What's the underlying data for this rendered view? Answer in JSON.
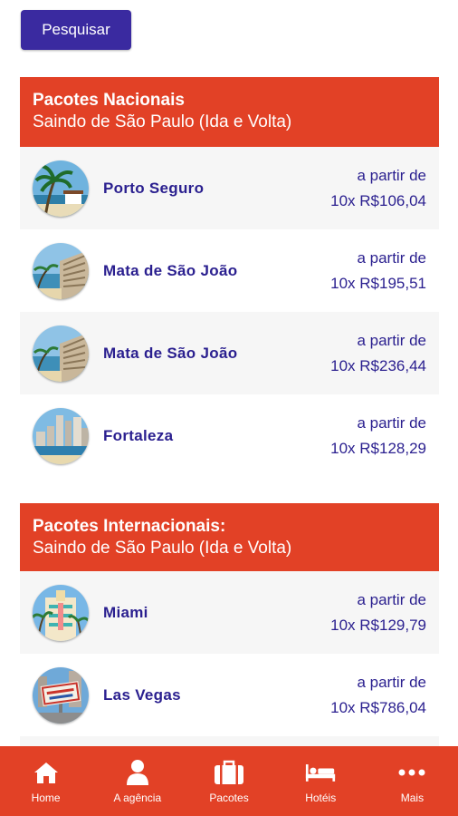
{
  "search": {
    "label": "Pesquisar"
  },
  "national": {
    "title": "Pacotes Nacionais",
    "subtitle": "Saindo de São Paulo (Ida e Volta)",
    "items": [
      {
        "name": "Porto Seguro",
        "from": "a partir de",
        "price": "10x R$106,04",
        "image": "beach-palm"
      },
      {
        "name": "Mata de São João",
        "from": "a partir de",
        "price": "10x R$195,51",
        "image": "resort"
      },
      {
        "name": "Mata de São João",
        "from": "a partir de",
        "price": "10x R$236,44",
        "image": "resort"
      },
      {
        "name": "Fortaleza",
        "from": "a partir de",
        "price": "10x R$128,29",
        "image": "city-beach"
      }
    ]
  },
  "international": {
    "title": "Pacotes Internacionais:",
    "subtitle": "Saindo de São Paulo (Ida e Volta)",
    "items": [
      {
        "name": "Miami",
        "from": "a partir de",
        "price": "10x R$129,79",
        "image": "art-deco"
      },
      {
        "name": "Las Vegas",
        "from": "a partir de",
        "price": "10x R$786,04",
        "image": "vegas-sign"
      }
    ]
  },
  "tabs": [
    {
      "label": "Home",
      "icon": "home-icon"
    },
    {
      "label": "A agência",
      "icon": "person-icon"
    },
    {
      "label": "Pacotes",
      "icon": "suitcase-icon"
    },
    {
      "label": "Hotéis",
      "icon": "bed-icon"
    },
    {
      "label": "Mais",
      "icon": "more-icon"
    }
  ],
  "colors": {
    "accent": "#e24126",
    "primary": "#3a2aa0",
    "text": "#2a1f8f",
    "row_alt": "#f6f6f6"
  }
}
